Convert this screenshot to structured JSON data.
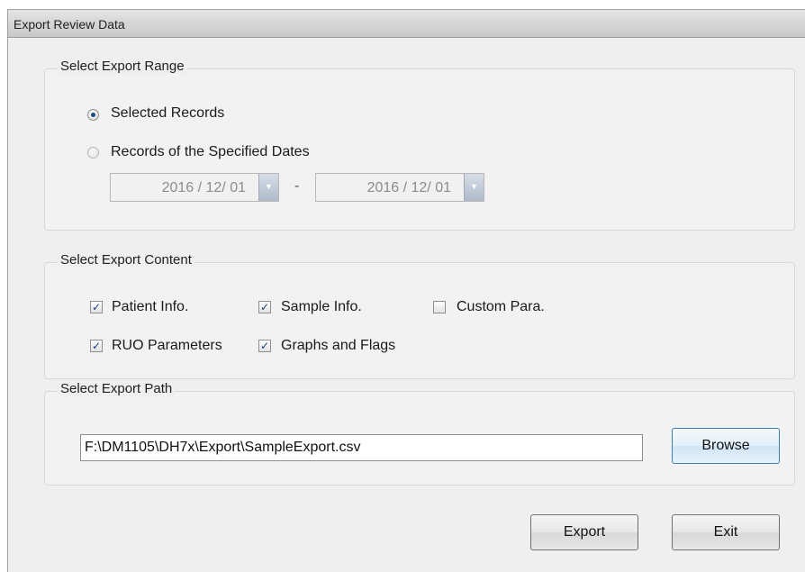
{
  "window": {
    "title": "Export Review Data"
  },
  "range_group": {
    "title": "Select Export Range",
    "radio_selected_label": "Selected Records",
    "radio_dates_label": "Records of the Specified Dates",
    "selected_option": "Selected Records",
    "date_from": "2016 / 12/ 01",
    "date_separator": "-",
    "date_to": "2016 / 12/ 01"
  },
  "content_group": {
    "title": "Select Export Content",
    "items": [
      {
        "label": "Patient Info.",
        "checked": true
      },
      {
        "label": "Sample Info.",
        "checked": true
      },
      {
        "label": "Custom Para.",
        "checked": false
      },
      {
        "label": "RUO Parameters",
        "checked": true
      },
      {
        "label": "Graphs and Flags",
        "checked": true
      }
    ]
  },
  "path_group": {
    "title": "Select Export Path",
    "path_value": "F:\\DM1105\\DH7x\\Export\\SampleExport.csv",
    "browse_label": "Browse"
  },
  "actions": {
    "export_label": "Export",
    "exit_label": "Exit"
  },
  "colors": {
    "dialog_bg": "#efefef",
    "radio_dot": "#1d4c86",
    "focus_border": "#3c7fb1"
  },
  "icons": {
    "check": "check-mark-icon",
    "dropdown": "chevron-down-icon"
  }
}
